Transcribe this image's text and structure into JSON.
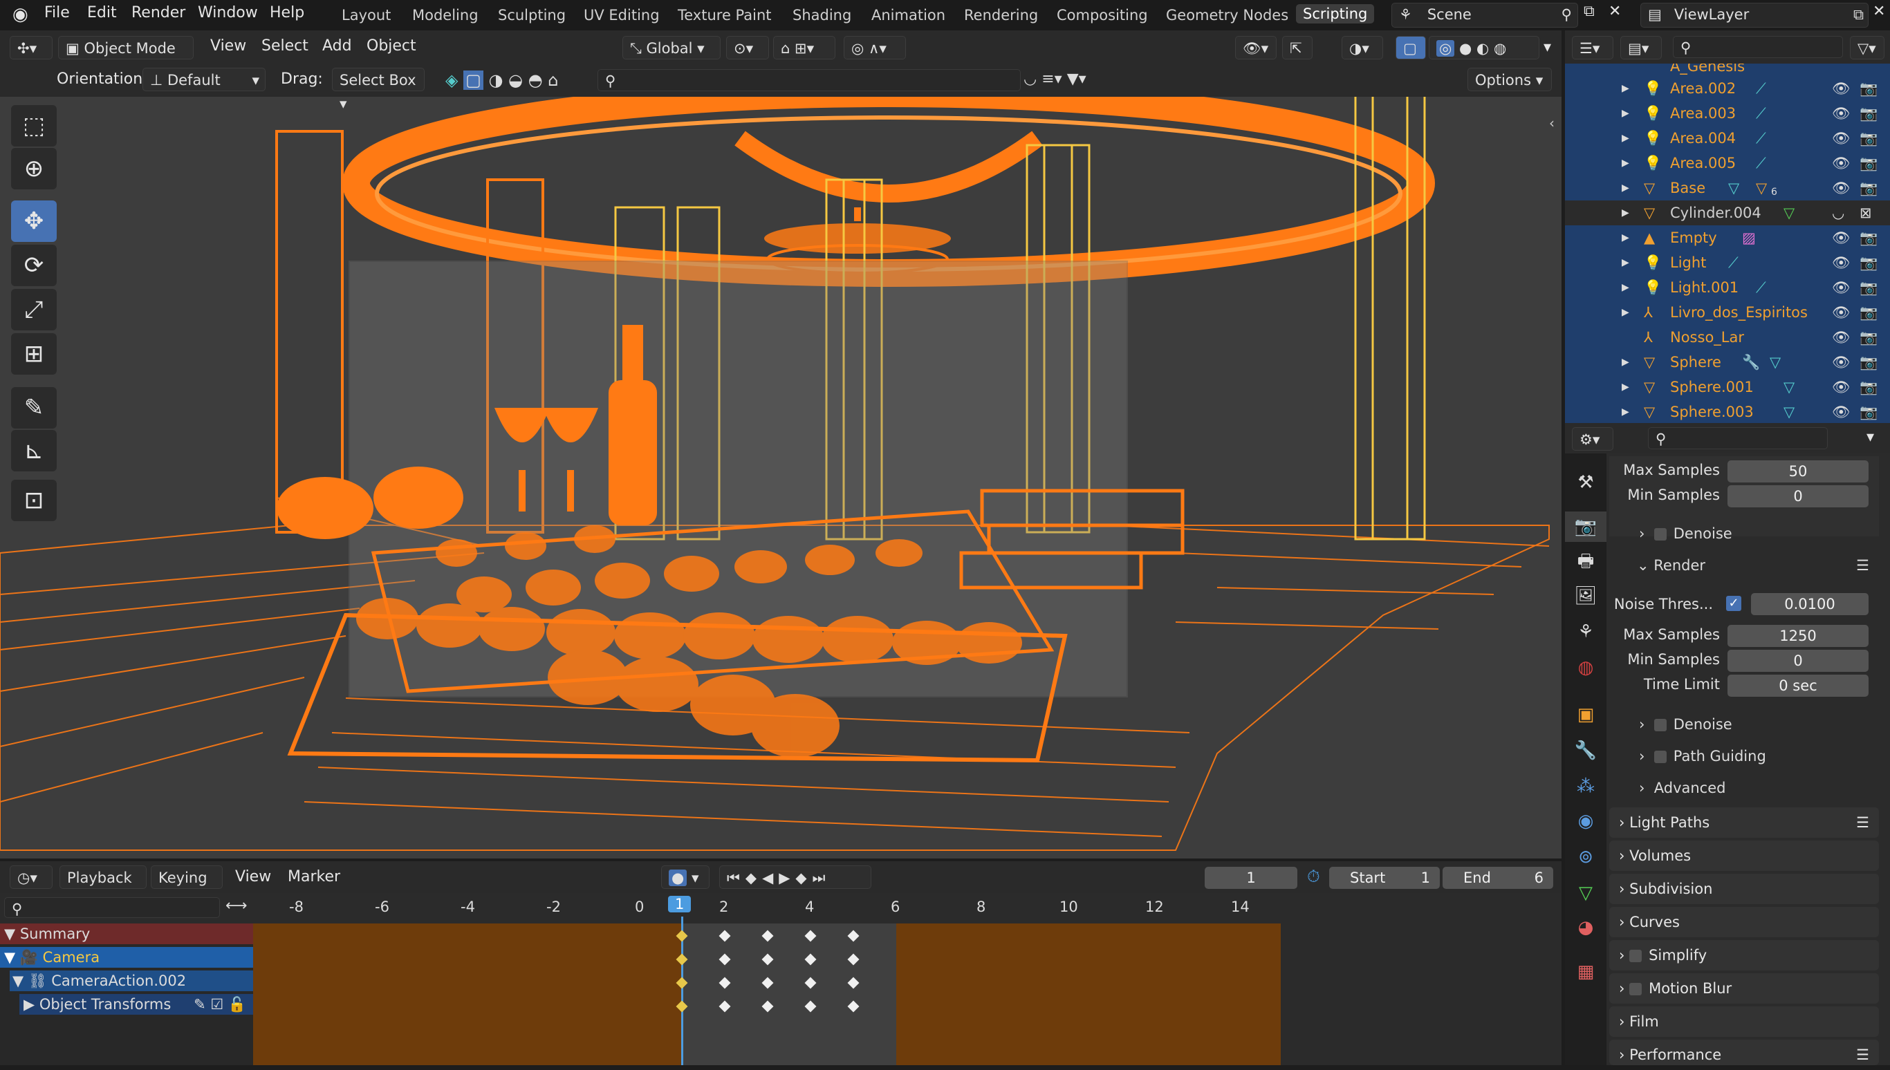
{
  "top_menu": {
    "file": "File",
    "edit": "Edit",
    "render": "Render",
    "window": "Window",
    "help": "Help"
  },
  "workspaces": [
    "Layout",
    "Modeling",
    "Sculpting",
    "UV Editing",
    "Texture Paint",
    "Shading",
    "Animation",
    "Rendering",
    "Compositing",
    "Geometry Nodes",
    "Scripting"
  ],
  "active_workspace": "Scripting",
  "scene_name": "Scene",
  "view_layer": "ViewLayer",
  "viewport_header": {
    "mode": "Object Mode",
    "view": "View",
    "select": "Select",
    "add": "Add",
    "object": "Object",
    "transform_orientation": "Global"
  },
  "tool_settings": {
    "orientation_label": "Orientation:",
    "orientation_value": "Default",
    "drag_label": "Drag:",
    "drag_value": "Select Box",
    "options": "Options"
  },
  "timeline": {
    "playback": "Playback",
    "keying": "Keying",
    "view": "View",
    "marker": "Marker",
    "current_frame": "1",
    "start_label": "Start",
    "start_value": "1",
    "end_label": "End",
    "end_value": "6"
  },
  "ruler": [
    "-8",
    "-6",
    "-4",
    "-2",
    "0",
    "1",
    "2",
    "4",
    "6",
    "8",
    "10",
    "12",
    "14"
  ],
  "channels": {
    "summary": "Summary",
    "camera": "Camera",
    "action": "CameraAction.002",
    "transforms": "Object Transforms"
  },
  "outliner": {
    "partial_top": "A_Genesis",
    "items": [
      {
        "name": "Area.002"
      },
      {
        "name": "Area.003"
      },
      {
        "name": "Area.004"
      },
      {
        "name": "Area.005"
      },
      {
        "name": "Base",
        "badge": "6"
      },
      {
        "name": "Cylinder.004"
      },
      {
        "name": "Empty"
      },
      {
        "name": "Light"
      },
      {
        "name": "Light.001"
      },
      {
        "name": "Livro_dos_Espiritos"
      },
      {
        "name": "Nosso_Lar"
      },
      {
        "name": "Sphere"
      },
      {
        "name": "Sphere.001"
      },
      {
        "name": "Sphere.003"
      }
    ]
  },
  "properties": {
    "viewport_max_samples_label": "Max Samples",
    "viewport_max_samples": "50",
    "viewport_min_samples_label": "Min Samples",
    "viewport_min_samples": "0",
    "denoise": "Denoise",
    "render_section": "Render",
    "noise_threshold_label": "Noise Thres...",
    "noise_threshold": "0.0100",
    "render_max_samples_label": "Max Samples",
    "render_max_samples": "1250",
    "render_min_samples_label": "Min Samples",
    "render_min_samples": "0",
    "time_limit_label": "Time Limit",
    "time_limit": "0 sec",
    "denoise2": "Denoise",
    "path_guiding": "Path Guiding",
    "advanced": "Advanced",
    "sections": [
      "Light Paths",
      "Volumes",
      "Subdivision",
      "Curves",
      "Simplify",
      "Motion Blur",
      "Film",
      "Performance"
    ]
  },
  "colors": {
    "accent": "#4772b3",
    "selection_orange": "#ff7a14",
    "outliner_bg": "#1f3e6c",
    "wire_yellow": "#f5c842"
  }
}
